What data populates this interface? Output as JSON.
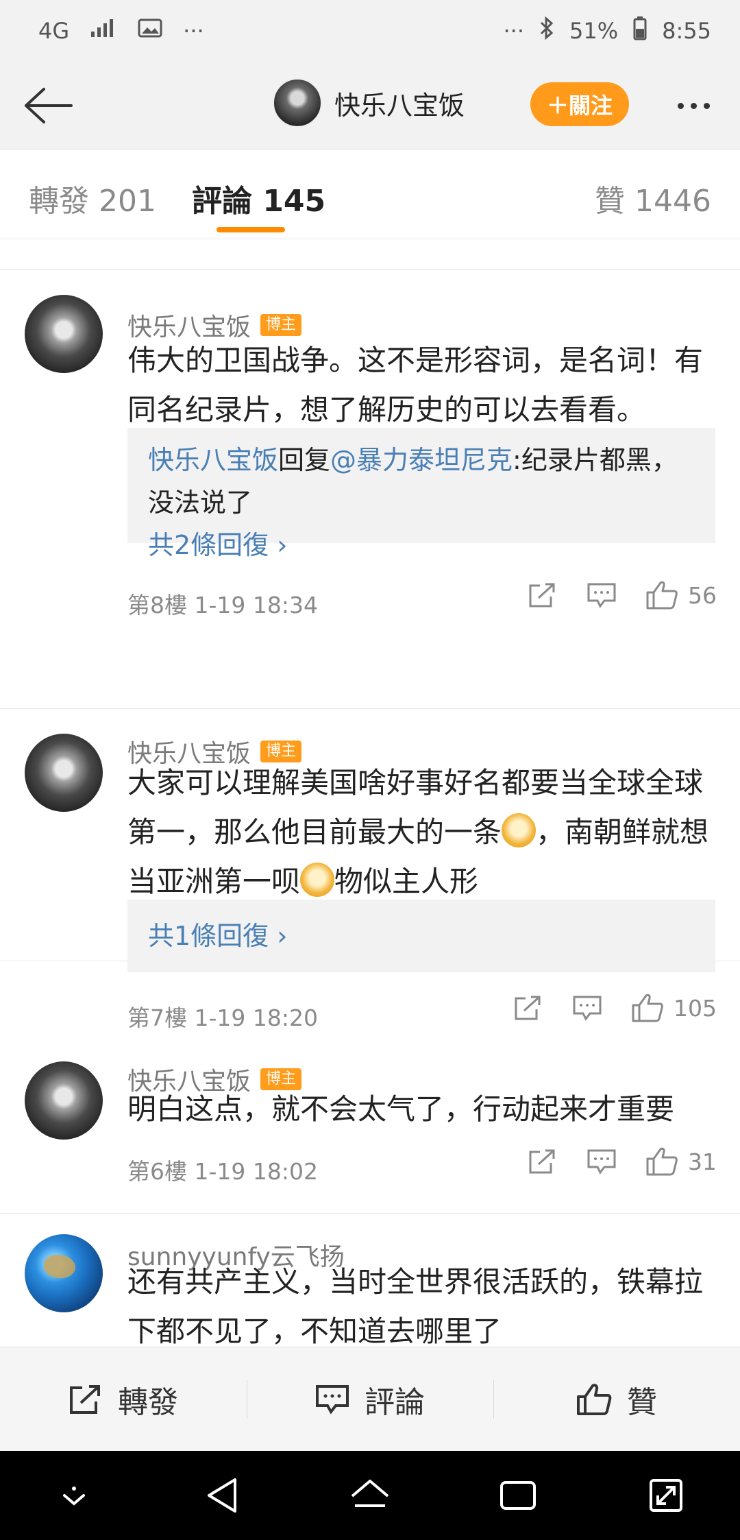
{
  "status_bar": {
    "network": "4G",
    "more": "···",
    "more_right": "···",
    "battery": "51%",
    "time": "8:55"
  },
  "nav": {
    "back_icon": "arrow-left-icon",
    "user_name": "快乐八宝饭",
    "follow_label": "＋關注",
    "more_icon": "ellipsis-icon"
  },
  "tabs": {
    "repost": "轉發 201",
    "comment": "評論 145",
    "like": "贊 1446",
    "active_color": "#ff8c00"
  },
  "comments": [
    {
      "name": "快乐八宝饭",
      "badge": "博主",
      "text": "伟大的卫国战争。这不是形容词，是名词！有同名纪录片，想了解历史的可以去看看。",
      "reply": {
        "author": "快乐八宝饭",
        "verb": "回复",
        "mention": "@暴力泰坦尼克",
        "content": ":纪录片都黑，没法说了",
        "count": "共2條回復 ›"
      },
      "meta": "第8樓  1-19 18:34",
      "likes": "56"
    },
    {
      "name": "快乐八宝饭",
      "badge": "博主",
      "text_part1": "大家可以理解美国啥好事好名都要当全球全球第一，那么他目前最大的一条",
      "text_part2": "，南朝鲜就想当亚洲第一呗",
      "text_part3": "物似主人形",
      "reply": {
        "count": "共1條回復 ›"
      },
      "meta": "第7樓  1-19 18:20",
      "likes": "105"
    },
    {
      "name": "快乐八宝饭",
      "badge": "博主",
      "text": "明白这点，就不会太气了，行动起来才重要",
      "meta": "第6樓  1-19 18:02",
      "likes": "31"
    },
    {
      "name": "sunnyyunfy云飞扬",
      "text": "还有共产主义，当时全世界很活跃的，铁幕拉下都不见了，不知道去哪里了"
    }
  ],
  "bottom_bar": {
    "repost": "轉發",
    "comment": "評論",
    "like": "贊"
  }
}
